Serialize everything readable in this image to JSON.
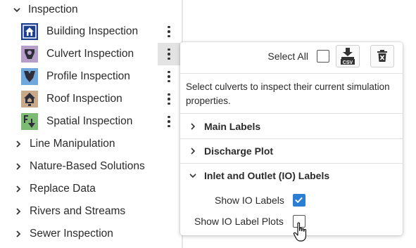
{
  "tree": {
    "section": {
      "label": "Inspection"
    },
    "tools": [
      {
        "label": "Building Inspection",
        "icon": "building-inspection-icon",
        "color": "#1c3f8f"
      },
      {
        "label": "Culvert Inspection",
        "icon": "culvert-inspection-icon",
        "color": "#b59ec8"
      },
      {
        "label": "Profile Inspection",
        "icon": "profile-inspection-icon",
        "color": "#6fa8dc"
      },
      {
        "label": "Roof Inspection",
        "icon": "roof-inspection-icon",
        "color": "#c8a98a"
      },
      {
        "label": "Spatial Inspection",
        "icon": "spatial-inspection-icon",
        "color": "#7dbb74"
      }
    ],
    "categories": [
      {
        "label": "Line Manipulation"
      },
      {
        "label": "Nature-Based Solutions"
      },
      {
        "label": "Replace Data"
      },
      {
        "label": "Rivers and Streams"
      },
      {
        "label": "Sewer Inspection"
      }
    ]
  },
  "popup": {
    "select_all_label": "Select All",
    "csv_label": "CSV",
    "description": "Select culverts to inspect their current simulation properties.",
    "sections": [
      {
        "label": "Main Labels",
        "expanded": false
      },
      {
        "label": "Discharge Plot",
        "expanded": false
      },
      {
        "label": "Inlet and Outlet (IO) Labels",
        "expanded": true
      }
    ],
    "options": [
      {
        "label": "Show IO Labels",
        "checked": true
      },
      {
        "label": "Show IO Label Plots",
        "checked": false
      }
    ]
  },
  "colors": {
    "accent": "#2a7fd4",
    "text": "#2b2b2b",
    "hover": "#e3e3e3"
  }
}
